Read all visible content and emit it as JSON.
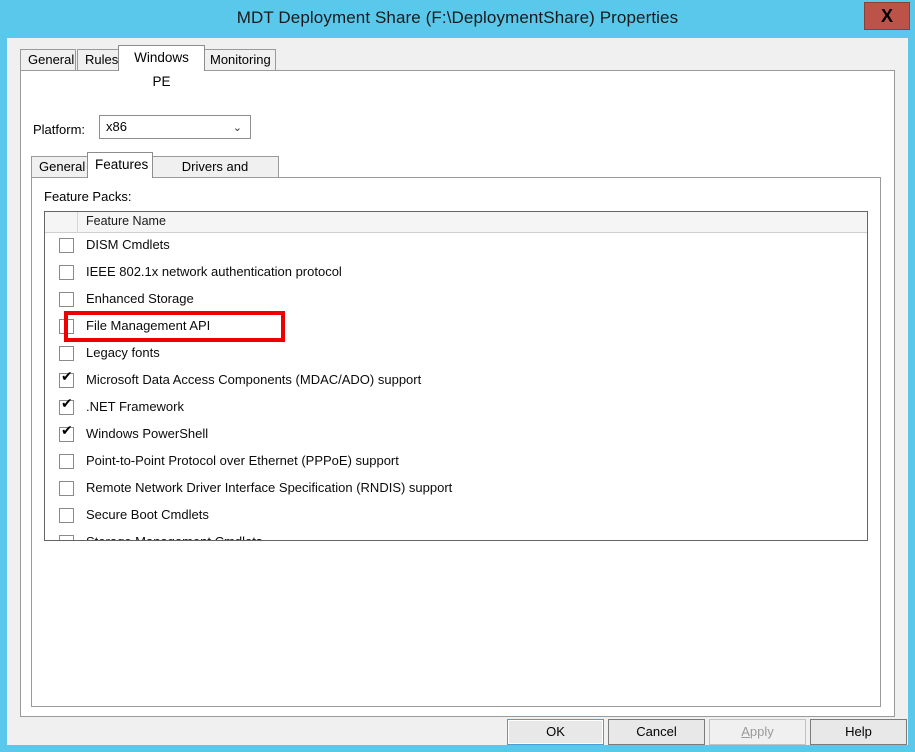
{
  "window": {
    "title": "MDT Deployment Share (F:\\DeploymentShare) Properties",
    "close_label": "X",
    "titlebar_color": "#5ac8ea",
    "close_color": "#bc5349"
  },
  "outer_tabs": [
    {
      "label": "General",
      "selected": false
    },
    {
      "label": "Rules",
      "selected": false
    },
    {
      "label": "Windows PE",
      "selected": true
    },
    {
      "label": "Monitoring",
      "selected": false
    }
  ],
  "platform": {
    "label": "Platform:",
    "value": "x86",
    "arrow": "⌄"
  },
  "inner_tabs": [
    {
      "label": "General",
      "selected": false
    },
    {
      "label": "Features",
      "selected": true
    },
    {
      "label": "Drivers and Patches",
      "selected": false
    }
  ],
  "features": {
    "group_label": "Feature Packs:",
    "columns": [
      "",
      "Feature Name"
    ],
    "rows": [
      {
        "label": "DISM Cmdlets",
        "checked": false
      },
      {
        "label": "IEEE 802.1x network authentication protocol",
        "checked": false
      },
      {
        "label": "Enhanced Storage",
        "checked": false
      },
      {
        "label": "File Management API",
        "checked": false,
        "highlighted": true
      },
      {
        "label": "Legacy fonts",
        "checked": false
      },
      {
        "label": "Microsoft Data Access Components (MDAC/ADO) support",
        "checked": true
      },
      {
        "label": ".NET Framework",
        "checked": true
      },
      {
        "label": "Windows PowerShell",
        "checked": true
      },
      {
        "label": "Point-to-Point Protocol over Ethernet (PPPoE) support",
        "checked": false
      },
      {
        "label": "Remote Network Driver Interface Specification (RNDIS) support",
        "checked": false
      },
      {
        "label": "Secure Boot Cmdlets",
        "checked": false
      },
      {
        "label": "Storage Management Cmdlets",
        "checked": false
      }
    ],
    "checkmark": "✔",
    "highlight_color": "#ee0000"
  },
  "buttons": [
    {
      "label": "OK",
      "state": "default"
    },
    {
      "label": "Cancel",
      "state": "normal"
    },
    {
      "label": "Apply",
      "state": "disabled"
    },
    {
      "label": "Help",
      "state": "normal"
    }
  ]
}
